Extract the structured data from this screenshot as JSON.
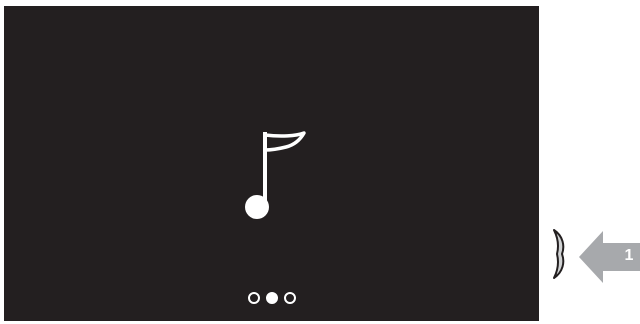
{
  "screen": {
    "background": "#231f20",
    "center_icon": "music-note-icon",
    "pager": {
      "count": 3,
      "active_index": 1
    }
  },
  "side_control": {
    "icon": "scroll-knob-icon"
  },
  "callout": {
    "number": "1",
    "arrow_color": "#a7a9ac"
  }
}
